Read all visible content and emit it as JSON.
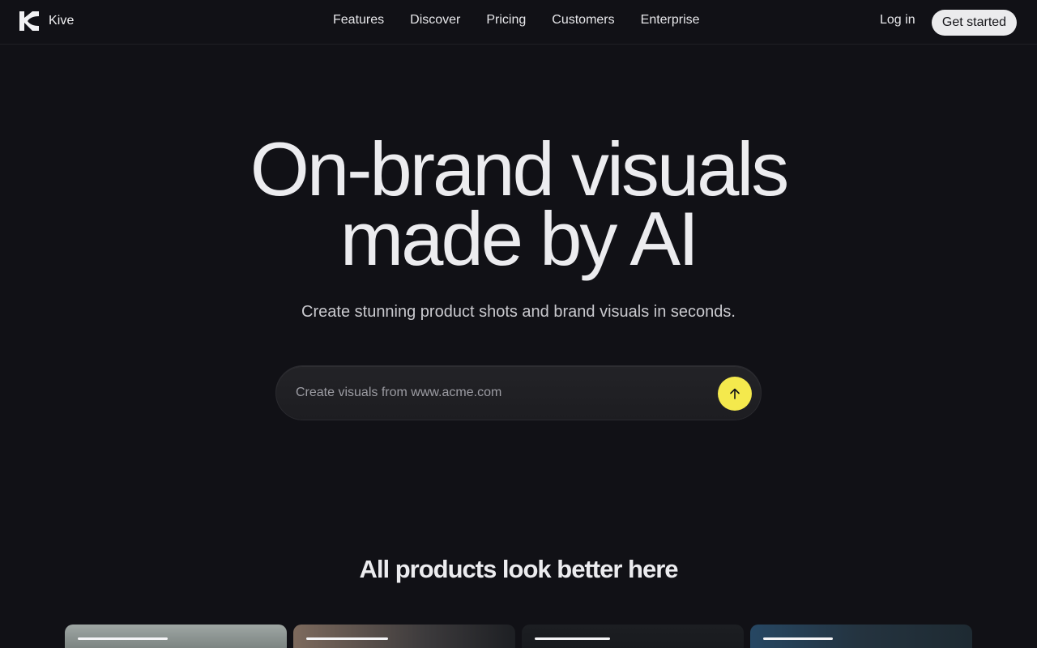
{
  "brand": {
    "name": "Kive",
    "logo_icon": "kive-logo-icon"
  },
  "nav": {
    "links": [
      "Features",
      "Discover",
      "Pricing",
      "Customers",
      "Enterprise"
    ],
    "login": "Log in",
    "cta": "Get started"
  },
  "hero": {
    "title_line1": "On-brand visuals",
    "title_line2": "made by AI",
    "subtitle": "Create stunning product shots and brand visuals in seconds."
  },
  "prompt": {
    "placeholder": "Create visuals from www.acme.com",
    "submit_icon": "arrow-up-icon",
    "accent": "#f4e94d"
  },
  "section": {
    "title": "All products look better here"
  }
}
